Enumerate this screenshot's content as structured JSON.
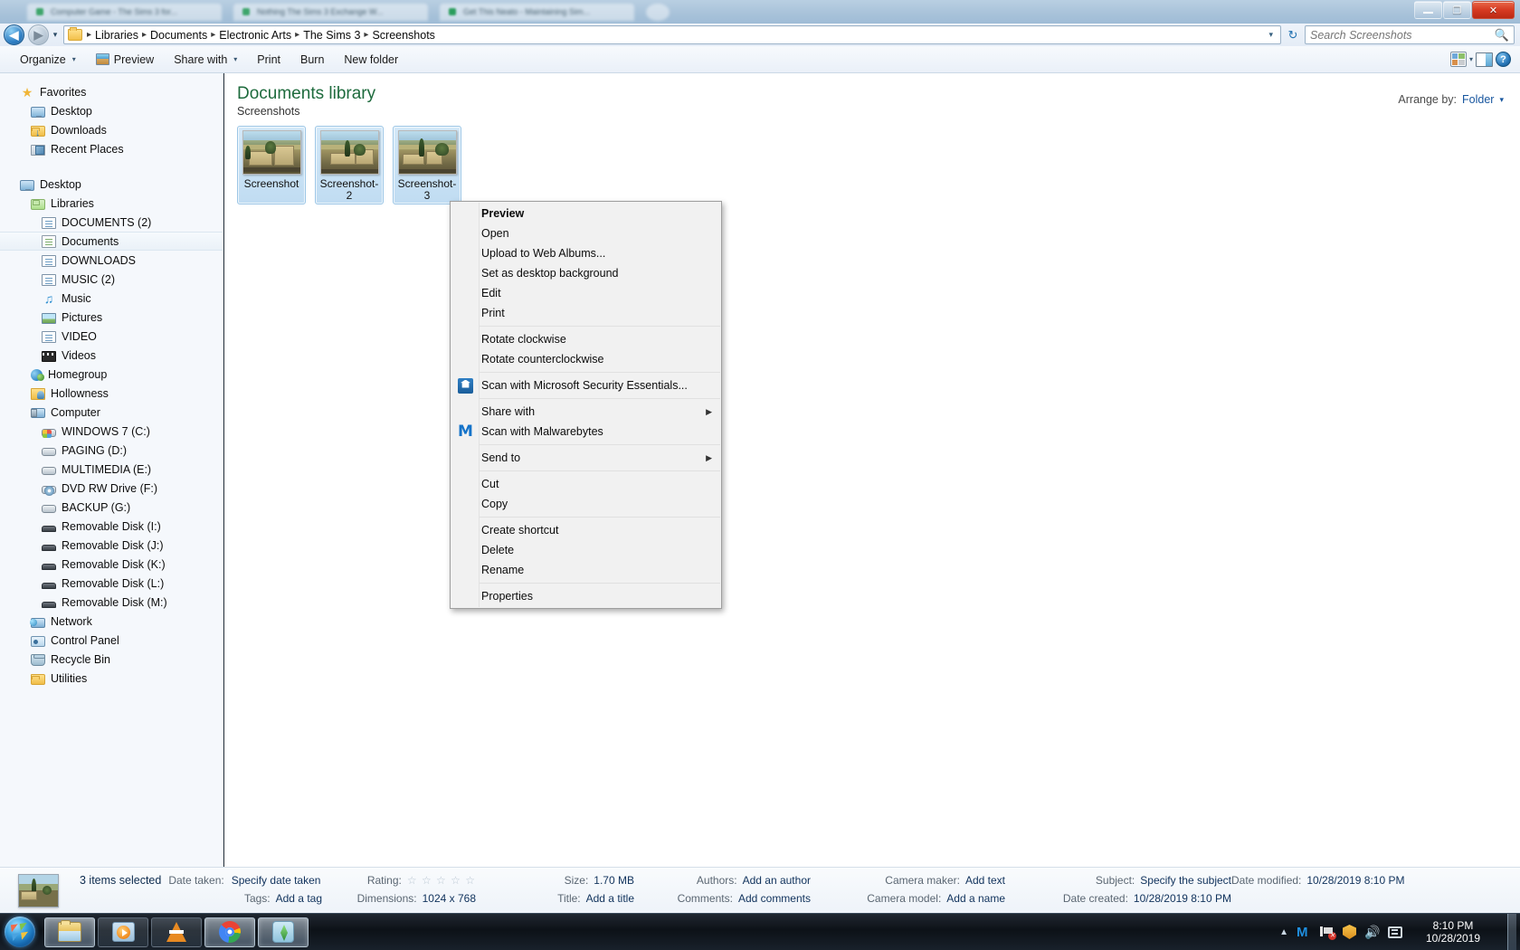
{
  "window": {
    "title_buttons": {
      "minimize": "–",
      "maximize": "❐",
      "close": "✕"
    }
  },
  "background_tabs": [
    {
      "label": "Computer Game - The Sims 3 for..."
    },
    {
      "label": "Nothing The Sims 3 Exchange W..."
    },
    {
      "label": "Get This Neato - Maintaining Sim..."
    }
  ],
  "address_bar": {
    "back_glyph": "◀",
    "forward_glyph": "▶",
    "history_caret": "▾",
    "crumbs": [
      "Libraries",
      "Documents",
      "Electronic Arts",
      "The Sims 3",
      "Screenshots"
    ],
    "separator": "▸",
    "dropdown_caret": "▾",
    "refresh_glyph": "↻"
  },
  "search": {
    "placeholder": "Search Screenshots",
    "value": "",
    "icon": "search-icon"
  },
  "command_bar": {
    "items": [
      {
        "label": "Organize",
        "caret": "▾",
        "icon": null
      },
      {
        "label": "Preview",
        "caret": "",
        "icon": "preview-icon"
      },
      {
        "label": "Share with",
        "caret": "▾",
        "icon": null
      },
      {
        "label": "Print",
        "caret": "",
        "icon": null
      },
      {
        "label": "Burn",
        "caret": "",
        "icon": null
      },
      {
        "label": "New folder",
        "caret": "",
        "icon": null
      }
    ],
    "right_icons": [
      {
        "name": "change-view-icon"
      },
      {
        "name": "change-view-caret",
        "glyph": "▾"
      },
      {
        "name": "show-preview-pane-icon"
      },
      {
        "name": "help-icon",
        "glyph": "?"
      }
    ]
  },
  "sidebar": {
    "groups": [
      {
        "header": {
          "label": "Favorites",
          "icon": "star-icon",
          "depth": 0
        },
        "items": [
          {
            "label": "Desktop",
            "icon": "monitor-icon",
            "depth": 1
          },
          {
            "label": "Downloads",
            "icon": "downloads-folder-icon",
            "depth": 1
          },
          {
            "label": "Recent Places",
            "icon": "recent-places-icon",
            "depth": 1
          }
        ]
      },
      {
        "header": {
          "label": "Desktop",
          "icon": "monitor-icon",
          "depth": 0
        },
        "items": [
          {
            "label": "Libraries",
            "icon": "libraries-icon",
            "depth": 1
          },
          {
            "label": "DOCUMENTS (2)",
            "icon": "library-icon",
            "depth": 2
          },
          {
            "label": "Documents",
            "icon": "documents-library-icon",
            "depth": 2,
            "selected": true
          },
          {
            "label": "DOWNLOADS",
            "icon": "library-icon",
            "depth": 2
          },
          {
            "label": "MUSIC (2)",
            "icon": "library-icon",
            "depth": 2
          },
          {
            "label": "Music",
            "icon": "music-icon",
            "depth": 2
          },
          {
            "label": "Pictures",
            "icon": "pictures-icon",
            "depth": 2
          },
          {
            "label": "VIDEO",
            "icon": "library-icon",
            "depth": 2
          },
          {
            "label": "Videos",
            "icon": "videos-icon",
            "depth": 2
          },
          {
            "label": "Homegroup",
            "icon": "homegroup-icon",
            "depth": 1
          },
          {
            "label": "Hollowness",
            "icon": "user-folder-icon",
            "depth": 1
          },
          {
            "label": "Computer",
            "icon": "computer-icon",
            "depth": 1
          },
          {
            "label": "WINDOWS 7 (C:)",
            "icon": "system-drive-icon",
            "depth": 2
          },
          {
            "label": "PAGING (D:)",
            "icon": "drive-icon",
            "depth": 2
          },
          {
            "label": "MULTIMEDIA (E:)",
            "icon": "drive-icon",
            "depth": 2
          },
          {
            "label": "DVD RW Drive (F:)",
            "icon": "dvd-drive-icon",
            "depth": 2
          },
          {
            "label": "BACKUP (G:)",
            "icon": "drive-icon",
            "depth": 2
          },
          {
            "label": "Removable Disk (I:)",
            "icon": "usb-drive-icon",
            "depth": 2
          },
          {
            "label": "Removable Disk (J:)",
            "icon": "usb-drive-icon",
            "depth": 2
          },
          {
            "label": "Removable Disk (K:)",
            "icon": "usb-drive-icon",
            "depth": 2
          },
          {
            "label": "Removable Disk (L:)",
            "icon": "usb-drive-icon",
            "depth": 2
          },
          {
            "label": "Removable Disk (M:)",
            "icon": "usb-drive-icon",
            "depth": 2
          },
          {
            "label": "Network",
            "icon": "network-icon",
            "depth": 1
          },
          {
            "label": "Control Panel",
            "icon": "control-panel-icon",
            "depth": 1
          },
          {
            "label": "Recycle Bin",
            "icon": "recycle-bin-icon",
            "depth": 1
          },
          {
            "label": "Utilities",
            "icon": "folder-icon",
            "depth": 1
          }
        ]
      }
    ]
  },
  "content": {
    "library_title": "Documents library",
    "library_subtitle": "Screenshots",
    "arrange_label": "Arrange by:",
    "arrange_value": "Folder",
    "arrange_caret": "▾",
    "files": [
      {
        "name": "Screenshot",
        "selected": true
      },
      {
        "name": "Screenshot-2",
        "selected": true
      },
      {
        "name": "Screenshot-3",
        "selected": true
      }
    ]
  },
  "context_menu": {
    "items": [
      {
        "label": "Preview",
        "bold": true
      },
      {
        "label": "Open"
      },
      {
        "label": "Upload to Web Albums..."
      },
      {
        "label": "Set as desktop background"
      },
      {
        "label": "Edit"
      },
      {
        "label": "Print"
      },
      {
        "separator": true
      },
      {
        "label": "Rotate clockwise"
      },
      {
        "label": "Rotate counterclockwise"
      },
      {
        "separator": true
      },
      {
        "label": "Scan with Microsoft Security Essentials...",
        "icon": "security-essentials-icon"
      },
      {
        "separator": true
      },
      {
        "label": "Share with",
        "submenu": "▶"
      },
      {
        "label": "Scan with Malwarebytes",
        "icon": "malwarebytes-icon"
      },
      {
        "separator": true
      },
      {
        "label": "Send to",
        "submenu": "▶"
      },
      {
        "separator": true
      },
      {
        "label": "Cut"
      },
      {
        "label": "Copy"
      },
      {
        "separator": true
      },
      {
        "label": "Create shortcut"
      },
      {
        "label": "Delete"
      },
      {
        "label": "Rename"
      },
      {
        "separator": true
      },
      {
        "label": "Properties"
      }
    ]
  },
  "details_pane": {
    "selection": "3 items selected",
    "columns": [
      [
        {
          "label": "Date taken:",
          "value": "Specify date taken"
        },
        {
          "label": "Tags:",
          "value": "Add a tag"
        }
      ],
      [
        {
          "label": "Rating:",
          "value": "☆ ☆ ☆ ☆ ☆",
          "is_rating": true
        },
        {
          "label": "Dimensions:",
          "value": "1024 x 768"
        }
      ],
      [
        {
          "label": "Size:",
          "value": "1.70 MB"
        },
        {
          "label": "Title:",
          "value": "Add a title"
        }
      ],
      [
        {
          "label": "Authors:",
          "value": "Add an author"
        },
        {
          "label": "Comments:",
          "value": "Add comments"
        }
      ],
      [
        {
          "label": "Camera maker:",
          "value": "Add text"
        },
        {
          "label": "Camera model:",
          "value": "Add a name"
        }
      ],
      [
        {
          "label": "Subject:",
          "value": "Specify the subject"
        },
        {
          "label": "Date created:",
          "value": "10/28/2019 8:10 PM"
        }
      ],
      [
        {
          "label": "Date modified:",
          "value": "10/28/2019 8:10 PM"
        },
        {
          "label": "",
          "value": ""
        }
      ]
    ]
  },
  "taskbar": {
    "start_button": "start-orb",
    "apps": [
      {
        "name": "windows-explorer",
        "active": true
      },
      {
        "name": "windows-media-player",
        "active": false
      },
      {
        "name": "vlc-media-player",
        "active": false
      },
      {
        "name": "google-chrome",
        "active": true
      },
      {
        "name": "the-sims-3",
        "active": true
      }
    ],
    "tray": [
      {
        "name": "show-hidden-icons",
        "glyph": "▲"
      },
      {
        "name": "malwarebytes-tray-icon",
        "glyph": "M"
      },
      {
        "name": "network-error-icon"
      },
      {
        "name": "action-center-icon"
      },
      {
        "name": "volume-icon",
        "glyph": "🔊"
      },
      {
        "name": "display-icon"
      }
    ],
    "clock_time": "8:10 PM",
    "clock_date": "10/28/2019"
  },
  "colors": {
    "library_title": "#1e6b3d",
    "link_blue": "#16559e",
    "selection_blue": "#c0dcf2",
    "close_red": "#d63a22"
  }
}
